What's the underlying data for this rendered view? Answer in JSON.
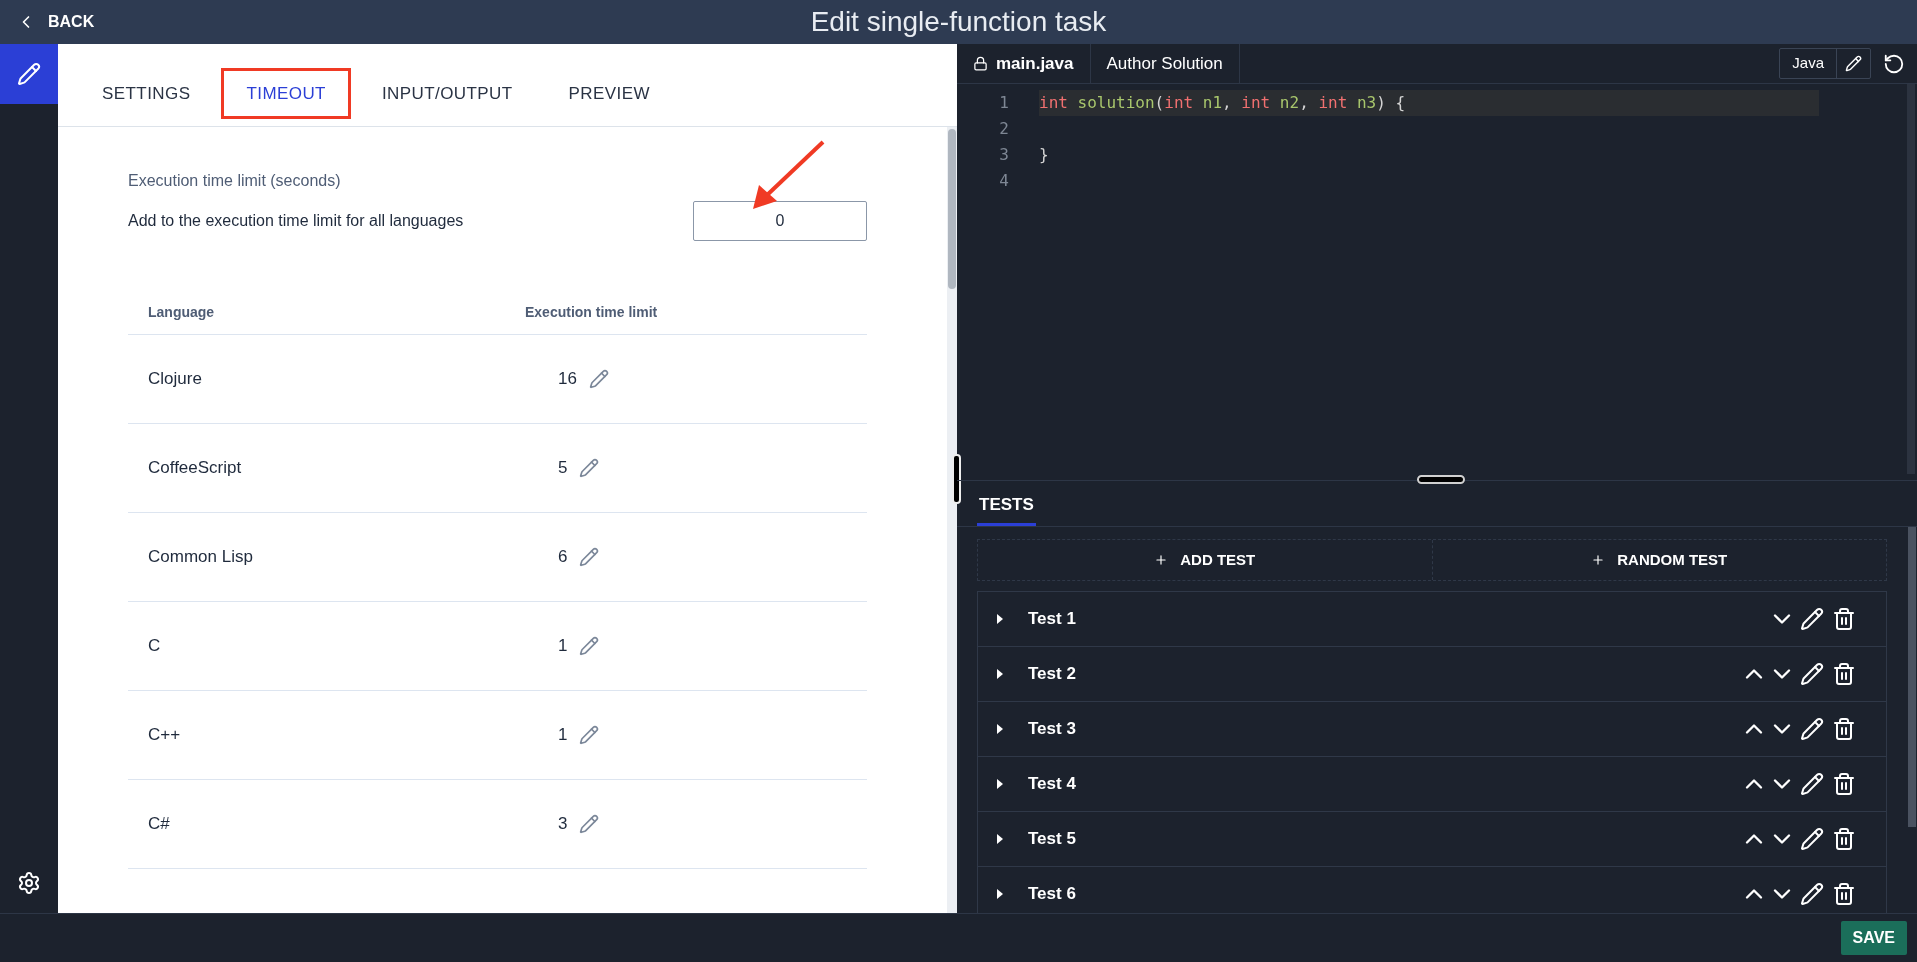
{
  "header": {
    "back": "BACK",
    "title": "Edit single-function task"
  },
  "tabs": [
    {
      "label": "SETTINGS",
      "selected": false,
      "annotated": false
    },
    {
      "label": "TIMEOUT",
      "selected": true,
      "annotated": true
    },
    {
      "label": "INPUT/OUTPUT",
      "selected": false,
      "annotated": false
    },
    {
      "label": "PREVIEW",
      "selected": false,
      "annotated": false
    }
  ],
  "timeout": {
    "section_title": "Execution time limit (seconds)",
    "label": "Add to the execution time limit for all languages",
    "value": "0",
    "annotated": true
  },
  "table": {
    "columns": [
      "Language",
      "Execution time limit"
    ],
    "rows": [
      {
        "language": "Clojure",
        "limit": "16"
      },
      {
        "language": "CoffeeScript",
        "limit": "5"
      },
      {
        "language": "Common Lisp",
        "limit": "6"
      },
      {
        "language": "C",
        "limit": "1"
      },
      {
        "language": "C++",
        "limit": "1"
      },
      {
        "language": "C#",
        "limit": "3"
      }
    ]
  },
  "editor": {
    "tabs": [
      {
        "label": "main.java",
        "selected": true,
        "locked": true
      },
      {
        "label": "Author Solution",
        "selected": false,
        "locked": false
      }
    ],
    "language": "Java",
    "lines": [
      {
        "number": "1",
        "current": true,
        "tokens": [
          {
            "kind": "keyword",
            "text": "int"
          },
          {
            "kind": "name",
            "text": " solution"
          },
          {
            "kind": "plain",
            "text": "("
          },
          {
            "kind": "keyword",
            "text": "int"
          },
          {
            "kind": "name",
            "text": " n1"
          },
          {
            "kind": "plain",
            "text": ", "
          },
          {
            "kind": "keyword",
            "text": "int"
          },
          {
            "kind": "name",
            "text": " n2"
          },
          {
            "kind": "plain",
            "text": ", "
          },
          {
            "kind": "keyword",
            "text": "int"
          },
          {
            "kind": "name",
            "text": " n3"
          },
          {
            "kind": "plain",
            "text": ") {"
          }
        ]
      },
      {
        "number": "2",
        "current": false
      },
      {
        "number": "3",
        "current": false,
        "tokens": [
          {
            "kind": "plain",
            "text": "}"
          }
        ]
      },
      {
        "number": "4",
        "current": false
      }
    ]
  },
  "tests": {
    "tab": "TESTS",
    "add": "ADD TEST",
    "random": "RANDOM TEST",
    "items": [
      {
        "name": "Test 1",
        "can_move_up": false
      },
      {
        "name": "Test 2",
        "can_move_up": true
      },
      {
        "name": "Test 3",
        "can_move_up": true
      },
      {
        "name": "Test 4",
        "can_move_up": true
      },
      {
        "name": "Test 5",
        "can_move_up": true
      },
      {
        "name": "Test 6",
        "can_move_up": true
      }
    ]
  },
  "save": "SAVE"
}
